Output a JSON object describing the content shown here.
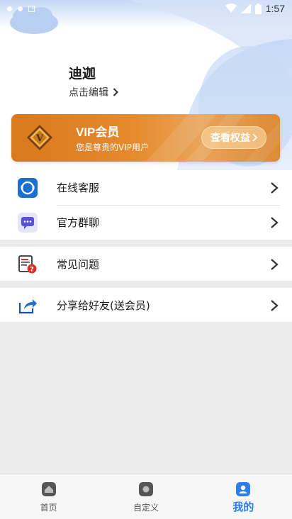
{
  "status_bar": {
    "time": "1:57"
  },
  "profile": {
    "name": "迪迦",
    "edit_label": "点击编辑"
  },
  "vip": {
    "title": "VIP会员",
    "subtitle": "您是尊贵的VIP用户",
    "button_label": "查看权益",
    "logo_letter": "V"
  },
  "menu_groups": [
    [
      {
        "label": "在线客服",
        "icon": "customer-service-icon"
      },
      {
        "label": "官方群聊",
        "icon": "chat-bubble-icon"
      }
    ],
    [
      {
        "label": "常见问题",
        "icon": "faq-document-icon"
      }
    ],
    [
      {
        "label": "分享给好友(送会员)",
        "icon": "share-icon"
      }
    ]
  ],
  "bottom_nav": [
    {
      "label": "首页",
      "icon": "home-icon",
      "active": false
    },
    {
      "label": "自定义",
      "icon": "custom-icon",
      "active": false
    },
    {
      "label": "我的",
      "icon": "profile-icon",
      "active": true
    }
  ],
  "colors": {
    "accent": "#2f7de8",
    "vip_orange": "#e58a2c",
    "page_bg": "#ececec"
  }
}
